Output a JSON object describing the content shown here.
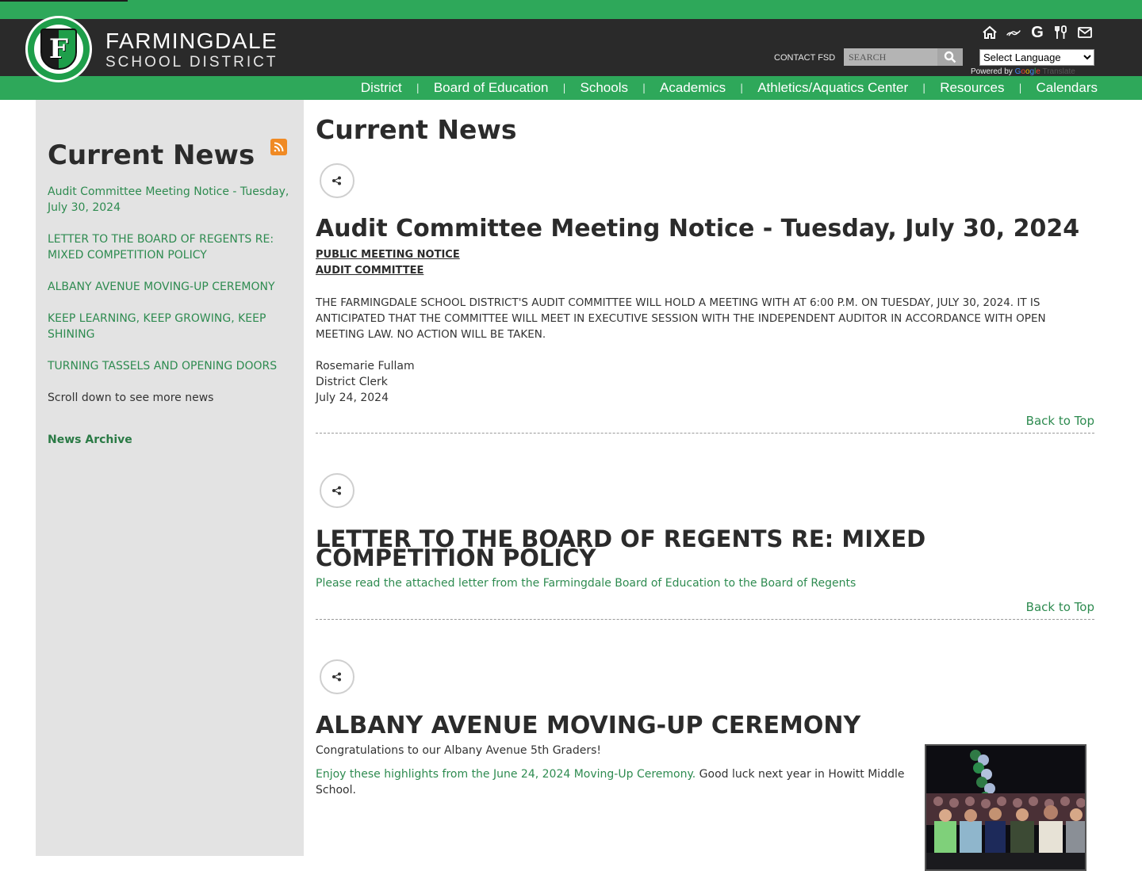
{
  "site": {
    "name_line1": "FARMINGDALE",
    "name_line2": "SCHOOL DISTRICT",
    "logo_letter": "F",
    "brand_color": "#2ea85a",
    "header_color": "#2a2a2a"
  },
  "utility": {
    "icons": [
      "home-icon",
      "link-icon",
      "google-icon",
      "food-services-icon",
      "mail-icon"
    ],
    "contact_label": "CONTACT FSD",
    "search_placeholder": "SEARCH",
    "language_selected": "Select Language",
    "powered_by": "Powered by",
    "google": [
      "G",
      "o",
      "o",
      "g",
      "l",
      "e"
    ],
    "translate": "Translate"
  },
  "nav": {
    "items": [
      "District",
      "Board of Education",
      "Schools",
      "Academics",
      "Athletics/Aquatics Center",
      "Resources",
      "Calendars"
    ]
  },
  "sidebar": {
    "title": "Current News",
    "links": [
      "Audit Committee Meeting Notice - Tuesday, July 30, 2024",
      "LETTER TO THE BOARD OF REGENTS RE: MIXED COMPETITION POLICY",
      "ALBANY AVENUE MOVING-UP CEREMONY",
      "KEEP LEARNING, KEEP GROWING, KEEP SHINING",
      "TURNING TASSELS AND OPENING DOORS"
    ],
    "note": "Scroll down to see more news",
    "archive_label": "News Archive"
  },
  "main": {
    "title": "Current News",
    "back_to_top": "Back to Top",
    "articles": [
      {
        "title": "Audit Committee Meeting Notice - Tuesday, July 30, 2024",
        "subheads": [
          "PUBLIC MEETING NOTICE",
          "AUDIT COMMITTEE"
        ],
        "body": "THE FARMINGDALE SCHOOL DISTRICT'S AUDIT COMMITTEE WILL HOLD A MEETING WITH AT 6:00 P.M. ON TUESDAY, JULY 30, 2024. IT IS ANTICIPATED THAT THE COMMITTEE WILL MEET IN EXECUTIVE SESSION WITH THE INDEPENDENT AUDITOR IN ACCORDANCE WITH OPEN MEETING LAW. NO ACTION WILL BE TAKEN.",
        "signature": [
          "Rosemarie Fullam",
          "District Clerk",
          "July 24, 2024"
        ]
      },
      {
        "title": "LETTER TO THE BOARD OF REGENTS RE: MIXED COMPETITION POLICY",
        "link_text": "Please read the attached letter from the Farmingdale Board of Education to the Board of Regents"
      },
      {
        "title": "ALBANY AVENUE MOVING-UP CEREMONY",
        "intro": "Congratulations to our Albany Avenue 5th Graders!",
        "link_text": "Enjoy these highlights from the June 24, 2024 Moving-Up Ceremony.",
        "tail_text": " Good luck next year in Howitt Middle School.",
        "image_alt": "Students seated at moving-up ceremony"
      }
    ]
  }
}
